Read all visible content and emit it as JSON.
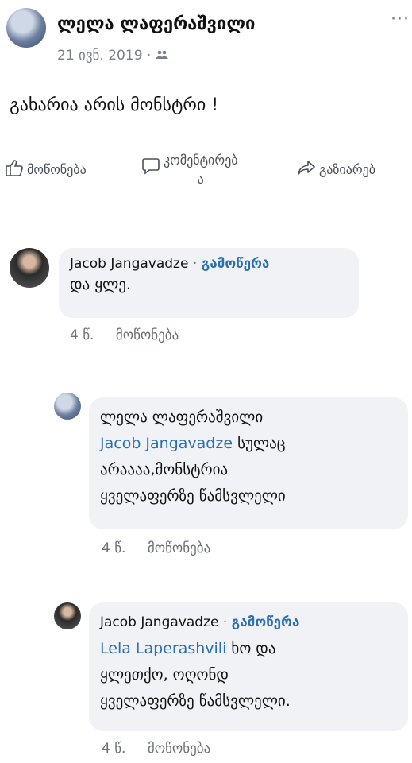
{
  "post": {
    "author": "ლელა ლაფერაშვილი",
    "date": "21 ივნ. 2019 ·",
    "audience_icon": "friends-icon",
    "text": "გახარია არის მონსტრი !",
    "more_label": "···"
  },
  "actions": {
    "like": "მოწონება",
    "comment_line1": "კომენტირებ",
    "comment_line2": "ა",
    "share": "გაზიარებ"
  },
  "comments": [
    {
      "author": "Jacob Jangavadze",
      "separator": "·",
      "subscribe": "გამოწერა",
      "text": "და ყლე.",
      "time": "4 წ.",
      "like": "მოწონება"
    },
    {
      "author": "ლელა ლაფერაშვილი",
      "mention": "Jacob Jangavadze",
      "text_line1_rest": "სულაც",
      "text_line2": "არაააა,მონსტრია",
      "text_line3": "ყველაფერზე წამსვლელი",
      "time": "4 წ.",
      "like": "მოწონება"
    },
    {
      "author": "Jacob Jangavadze",
      "separator": "·",
      "subscribe": "გამოწერა",
      "mention": "Lela Laperashvili",
      "text_line1_rest": "ხო და",
      "text_line2": "ყლეთქო, ოღონდ",
      "text_line3": "ყველაფერზე წამსვლელი.",
      "time": "4 წ.",
      "like": "მოწონება"
    }
  ]
}
